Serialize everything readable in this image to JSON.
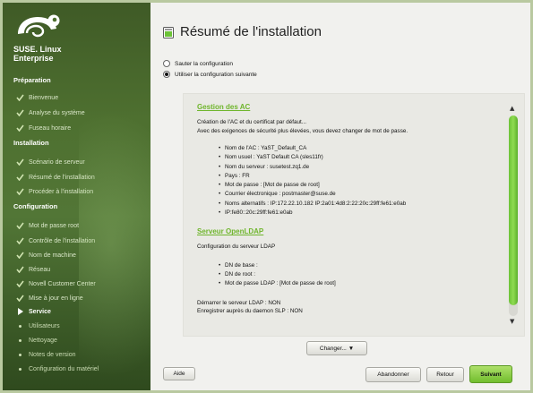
{
  "brand": {
    "line1": "SUSE. Linux",
    "line2": "Enterprise"
  },
  "sidebar": {
    "sections": [
      {
        "label": "Préparation",
        "items": [
          {
            "label": "Bienvenue",
            "state": "done"
          },
          {
            "label": "Analyse du système",
            "state": "done"
          },
          {
            "label": "Fuseau horaire",
            "state": "done"
          }
        ]
      },
      {
        "label": "Installation",
        "items": [
          {
            "label": "Scénario de serveur",
            "state": "done"
          },
          {
            "label": "Résumé de l'installation",
            "state": "done"
          },
          {
            "label": "Procéder à l'installation",
            "state": "done"
          }
        ]
      },
      {
        "label": "Configuration",
        "items": [
          {
            "label": "Mot de passe root",
            "state": "done"
          },
          {
            "label": "Contrôle de l'installation",
            "state": "done"
          },
          {
            "label": "Nom de machine",
            "state": "done"
          },
          {
            "label": "Réseau",
            "state": "done"
          },
          {
            "label": "Novell Customer Center",
            "state": "done"
          },
          {
            "label": "Mise à jour en ligne",
            "state": "done"
          },
          {
            "label": "Service",
            "state": "current"
          },
          {
            "label": "Utilisateurs",
            "state": "future"
          },
          {
            "label": "Nettoyage",
            "state": "future"
          },
          {
            "label": "Notes de version",
            "state": "future"
          },
          {
            "label": "Configuration du matériel",
            "state": "future"
          }
        ]
      }
    ]
  },
  "main": {
    "title": "Résumé de l'installation",
    "options": [
      {
        "label": "Sauter la configuration",
        "selected": false
      },
      {
        "label": "Utiliser la configuration suivante",
        "selected": true
      }
    ]
  },
  "summary": {
    "ca": {
      "heading": "Gestion des AC",
      "intro1": "Création de l'AC et du certificat par défaut...",
      "intro2": "Avec des exigences de sécurité plus élevées, vous devez changer de mot de passe.",
      "bullets": [
        "Nom de l'AC : YaST_Default_CA",
        "Nom usuel : YaST Default CA (sles11fr)",
        "Nom du serveur : susetest.zq1.de",
        "Pays : FR",
        "Mot de passe : [Mot de passe de root]",
        "Courrier électronique : postmaster@suse.de",
        "Noms alternatifs : IP:172.22.10.182 IP:2a01:4d8:2:22:20c:29ff:fe61:e0ab",
        "IP:fe80::20c:29ff:fe61:e0ab"
      ]
    },
    "ldap": {
      "heading": "Serveur OpenLDAP",
      "intro": "Configuration du serveur LDAP",
      "bullets": [
        "DN de base :",
        "DN de root :",
        "Mot de passe LDAP : [Mot de passe de root]"
      ],
      "line1": "Démarrer le serveur LDAP : NON",
      "line2": "Enregistrer auprès du daemon SLP : NON"
    }
  },
  "buttons": {
    "change": "Changer...",
    "help": "Aide",
    "abort": "Abandonner",
    "back": "Retour",
    "next": "Suivant"
  },
  "colors": {
    "accent": "#6fb52c",
    "sidebar": "#4e7030"
  }
}
